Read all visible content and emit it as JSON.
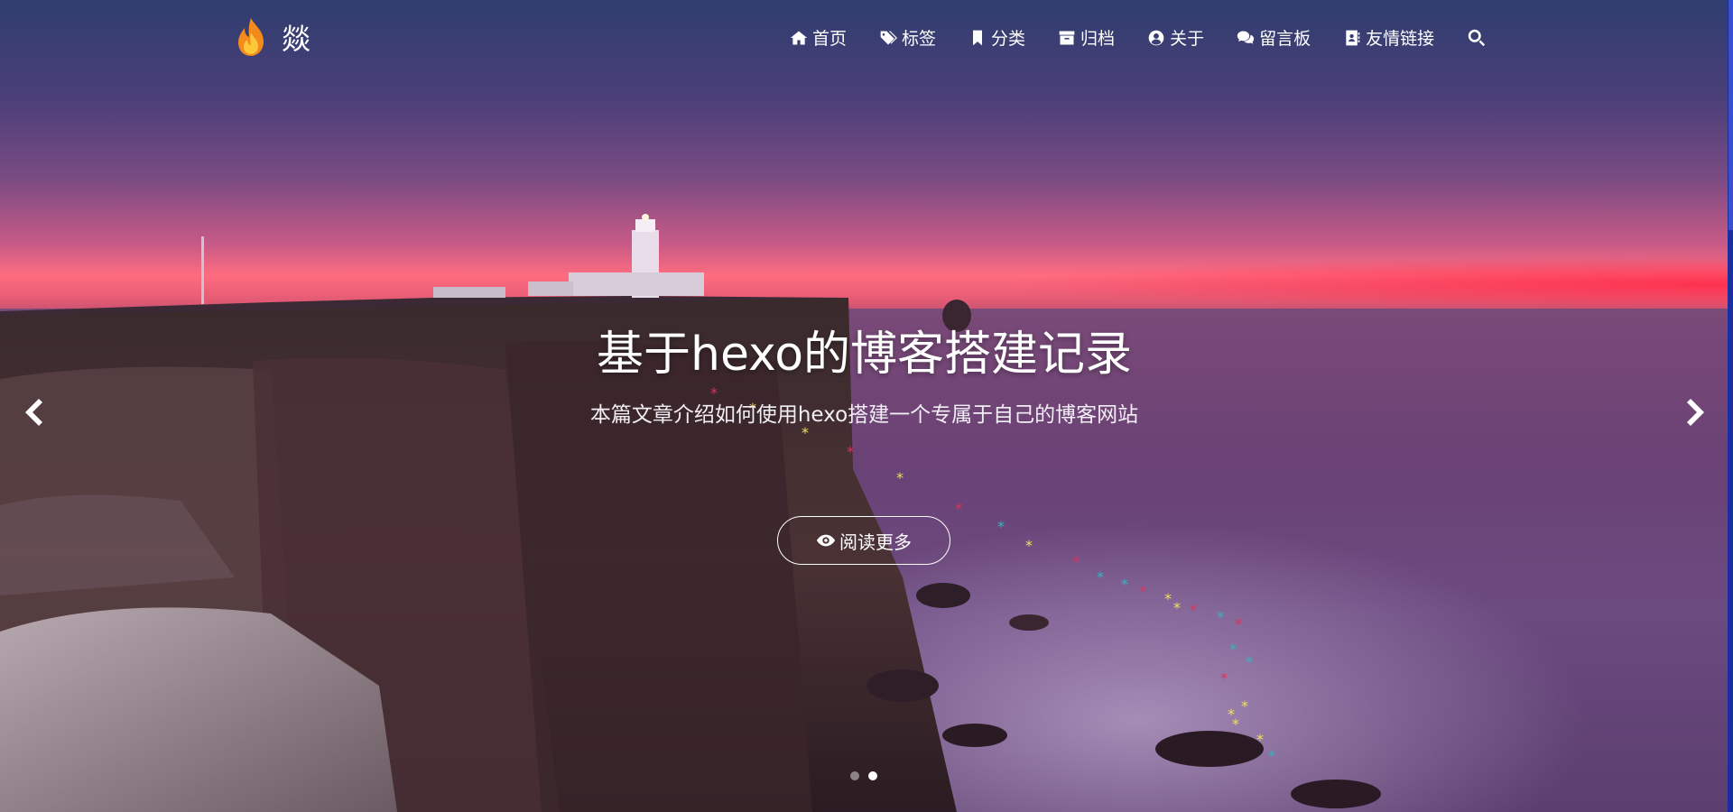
{
  "brand": {
    "name": "燚",
    "logo_icon": "flame-icon"
  },
  "nav": {
    "items": [
      {
        "label": "首页",
        "icon": "home-icon"
      },
      {
        "label": "标签",
        "icon": "tags-icon"
      },
      {
        "label": "分类",
        "icon": "bookmark-icon"
      },
      {
        "label": "归档",
        "icon": "archive-icon"
      },
      {
        "label": "关于",
        "icon": "user-circle-icon"
      },
      {
        "label": "留言板",
        "icon": "comments-icon"
      },
      {
        "label": "友情链接",
        "icon": "address-book-icon"
      }
    ],
    "search_icon": "search-icon"
  },
  "hero": {
    "title": "基于hexo的博客搭建记录",
    "description": "本篇文章介绍如何使用hexo搭建一个专属于自己的博客网站",
    "button_label": "阅读更多",
    "button_icon": "eye-icon"
  },
  "carousel": {
    "slide_count": 2,
    "active_slide": 2,
    "prev_icon": "chevron-left-icon",
    "next_icon": "chevron-right-icon"
  },
  "colors": {
    "sky_top": "#2f3d6f",
    "horizon": "#ff6c80",
    "sea": "#6a4275",
    "star_red": "#e0305a",
    "star_yellow": "#f0e060",
    "star_teal": "#30b8c0"
  }
}
